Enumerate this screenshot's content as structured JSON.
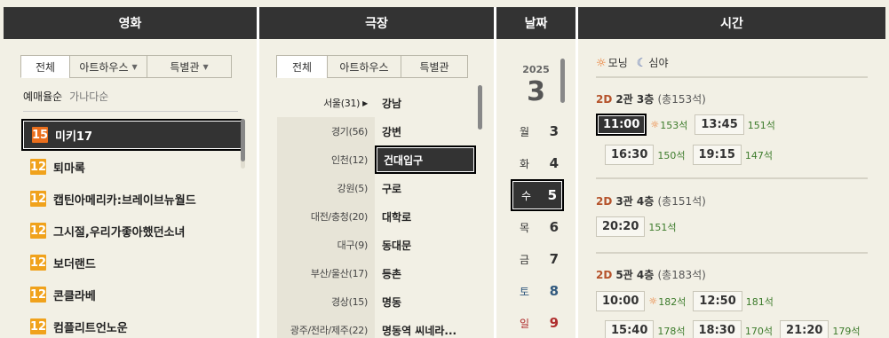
{
  "headers": {
    "movie": "영화",
    "theater": "극장",
    "date": "날짜",
    "time": "시간"
  },
  "movie": {
    "tabs": [
      {
        "label": "전체"
      },
      {
        "label": "아트하우스"
      },
      {
        "label": "특별관"
      }
    ],
    "sort": {
      "by_rate": "예매율순",
      "by_name": "가나다순"
    },
    "list": [
      {
        "rating": "15",
        "title": "미키17"
      },
      {
        "rating": "12",
        "title": "퇴마록"
      },
      {
        "rating": "12",
        "title": "캡틴아메리카:브레이브뉴월드"
      },
      {
        "rating": "12",
        "title": "그시절,우리가좋아했던소녀"
      },
      {
        "rating": "12",
        "title": "보더랜드"
      },
      {
        "rating": "12",
        "title": "콘클라베"
      },
      {
        "rating": "12",
        "title": "컴플리트언노운"
      }
    ]
  },
  "theater": {
    "tabs": [
      {
        "label": "전체"
      },
      {
        "label": "아트하우스"
      },
      {
        "label": "특별관"
      }
    ],
    "rows": [
      {
        "region": "서울(31)",
        "theater": "강남"
      },
      {
        "region": "경기(56)",
        "theater": "강변"
      },
      {
        "region": "인천(12)",
        "theater": "건대입구"
      },
      {
        "region": "강원(5)",
        "theater": "구로"
      },
      {
        "region": "대전/충청(20)",
        "theater": "대학로"
      },
      {
        "region": "대구(9)",
        "theater": "동대문"
      },
      {
        "region": "부산/울산(17)",
        "theater": "등촌"
      },
      {
        "region": "경상(15)",
        "theater": "명동"
      },
      {
        "region": "광주/전라/제주(22)",
        "theater": "명동역 씨네라..."
      }
    ]
  },
  "date": {
    "year": "2025",
    "month": "3",
    "days": [
      {
        "dow": "월",
        "day": "3"
      },
      {
        "dow": "화",
        "day": "4"
      },
      {
        "dow": "수",
        "day": "5"
      },
      {
        "dow": "목",
        "day": "6"
      },
      {
        "dow": "금",
        "day": "7"
      },
      {
        "dow": "토",
        "day": "8"
      },
      {
        "dow": "일",
        "day": "9"
      }
    ]
  },
  "time": {
    "legend": {
      "morning": "모닝",
      "night": "심야"
    },
    "halls": [
      {
        "format": "2D",
        "name": "2관 3층",
        "capacity": "(총153석)",
        "slots": [
          {
            "time": "11:00",
            "seats": "153석"
          },
          {
            "time": "13:45",
            "seats": "151석"
          },
          {
            "time": "16:30",
            "seats": "150석"
          },
          {
            "time": "19:15",
            "seats": "147석"
          }
        ]
      },
      {
        "format": "2D",
        "name": "3관 4층",
        "capacity": "(총151석)",
        "slots": [
          {
            "time": "20:20",
            "seats": "151석"
          }
        ]
      },
      {
        "format": "2D",
        "name": "5관 4층",
        "capacity": "(총183석)",
        "slots": [
          {
            "time": "10:00",
            "seats": "182석"
          },
          {
            "time": "12:50",
            "seats": "181석"
          },
          {
            "time": "15:40",
            "seats": "178석"
          },
          {
            "time": "18:30",
            "seats": "170석"
          },
          {
            "time": "21:20",
            "seats": "179석"
          }
        ]
      }
    ]
  },
  "colors": {
    "header_bg": "#333333",
    "panel_bg": "#f2f0e5",
    "rating_12": "#f0a21c",
    "rating_15": "#e96e1c",
    "seats": "#3c7b2b",
    "saturday": "#31597e",
    "sunday": "#af2d2d"
  },
  "icons": {
    "morning": "sun-icon",
    "night": "moon-icon"
  }
}
